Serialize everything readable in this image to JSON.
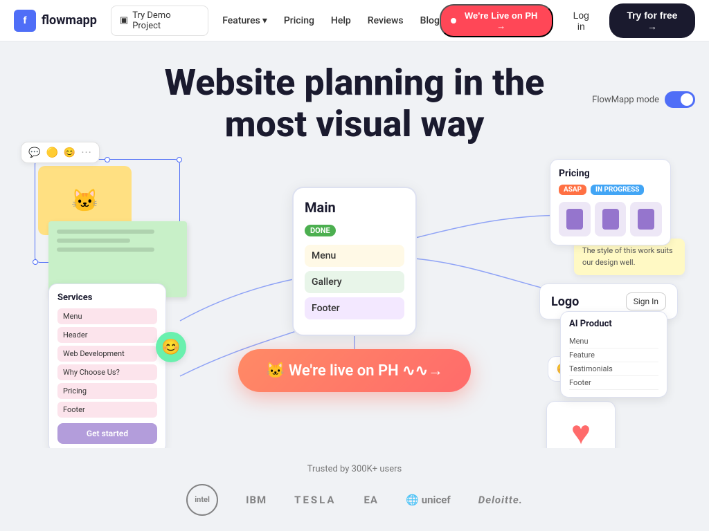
{
  "nav": {
    "logo_text": "flowmapp",
    "demo_label": "Try Demo Project",
    "links": [
      {
        "label": "Features",
        "has_dropdown": true
      },
      {
        "label": "Pricing"
      },
      {
        "label": "Help"
      },
      {
        "label": "Reviews"
      },
      {
        "label": "Blog"
      }
    ],
    "live_label": "We're Live on PH →",
    "login_label": "Log in",
    "try_free_label": "Try for free →"
  },
  "flowmapp_mode_label": "FlowMapp mode",
  "hero": {
    "title_line1": "Website planning in the",
    "title_line2": "most visual way"
  },
  "main_card": {
    "title": "Main",
    "badge": "DONE",
    "items": [
      "Menu",
      "Gallery",
      "Footer"
    ]
  },
  "live_cta": "🐱 We're live on PH  ∿∿→",
  "services_card": {
    "title": "Services",
    "items": [
      "Menu",
      "Header",
      "Web Development",
      "Why Choose Us?",
      "Pricing",
      "Footer"
    ]
  },
  "get_started_label": "Get started",
  "pricing_card": {
    "title": "Pricing",
    "badge1": "ASAP",
    "badge2": "IN PROGRESS"
  },
  "logo_signin": {
    "logo": "Logo",
    "signin": "Sign In"
  },
  "ai_card": {
    "title": "AI Product",
    "items": [
      "Menu",
      "Feature",
      "Testimonials",
      "Footer"
    ]
  },
  "trusted_text": "Trusted by 300K+ users",
  "brands": [
    "intel",
    "IBM",
    "TESLA",
    "EA",
    "unicef",
    "Deloitte."
  ]
}
